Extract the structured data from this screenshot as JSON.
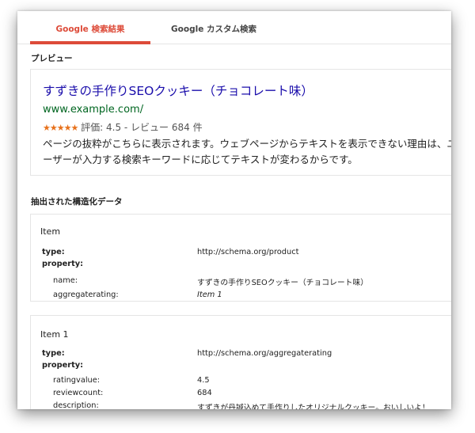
{
  "tabs": [
    "Google 検索結果",
    "Google カスタム検索"
  ],
  "preview": {
    "section_label": "プレビュー",
    "title": "すずきの手作りSEOクッキー（チョコレート味）",
    "url": "www.example.com/",
    "stars": "★★★★★",
    "rating_text": "評価: 4.5 - レビュー 684 件",
    "snippet_line1": "ページの抜粋がこちらに表示されます。ウェブページからテキストを表示できない理由は、ユ",
    "snippet_line2": "ーザーが入力する検索キーワードに応じてテキストが変わるからです。"
  },
  "structured": {
    "section_label": "抽出された構造化データ",
    "items": [
      {
        "title": "Item",
        "type_label": "type:",
        "type_value": "http://schema.org/product",
        "property_label": "property:",
        "properties": [
          {
            "key": "name:",
            "value": "すずきの手作りSEOクッキー（チョコレート味）"
          },
          {
            "key": "aggregaterating:",
            "value": "Item 1"
          }
        ]
      },
      {
        "title": "Item 1",
        "type_label": "type:",
        "type_value": "http://schema.org/aggregaterating",
        "property_label": "property:",
        "properties": [
          {
            "key": "ratingvalue:",
            "value": "4.5"
          },
          {
            "key": "reviewcount:",
            "value": "684"
          },
          {
            "key": "description:",
            "value": "すずきが丹誠込めて手作りしたオリジナルクッキー。おいしいよ！"
          }
        ]
      }
    ]
  }
}
